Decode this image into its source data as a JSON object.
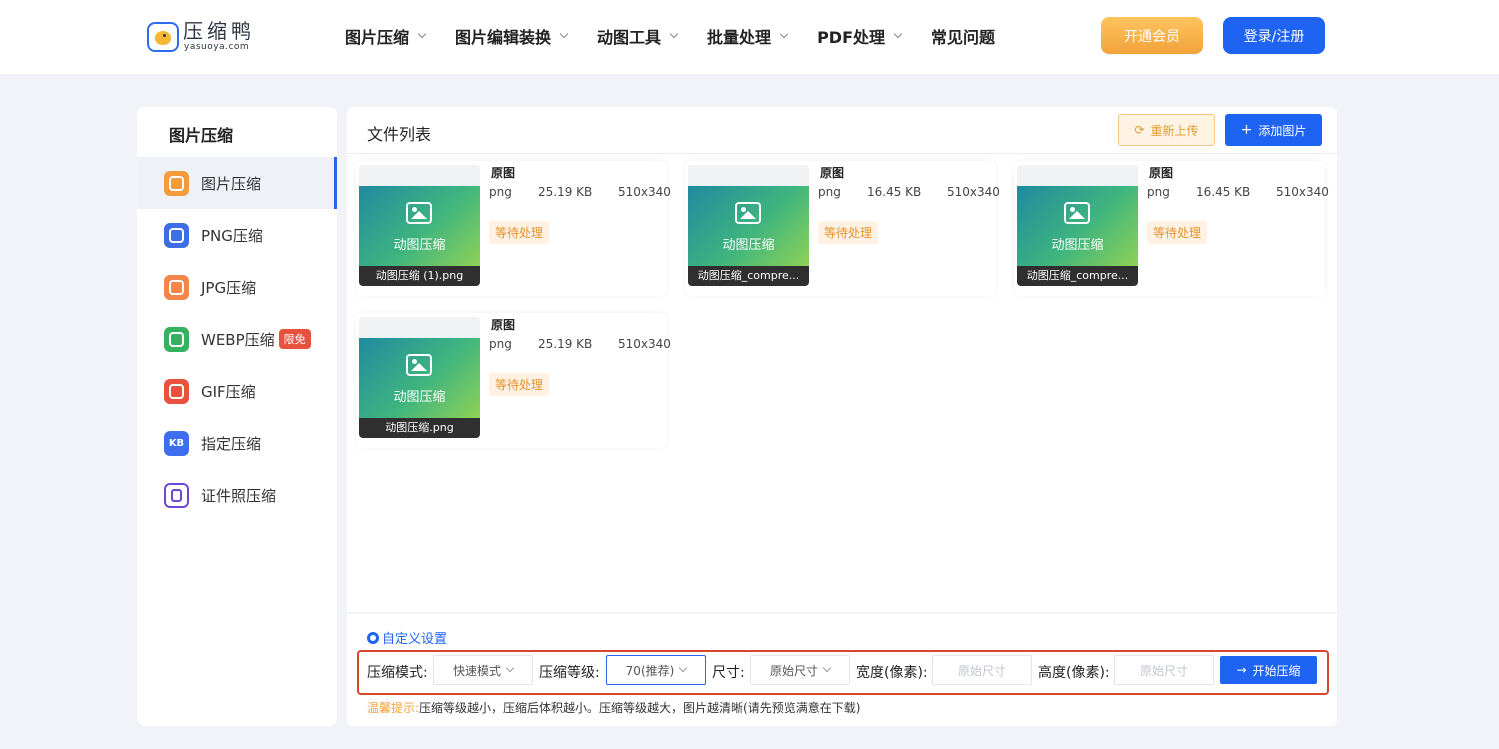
{
  "header": {
    "logo_title": "压缩鸭",
    "logo_sub": "yasuoya.com",
    "nav": [
      {
        "label": "图片压缩",
        "has_dropdown": true
      },
      {
        "label": "图片编辑装换",
        "has_dropdown": true
      },
      {
        "label": "动图工具",
        "has_dropdown": true
      },
      {
        "label": "批量处理",
        "has_dropdown": true
      },
      {
        "label": "PDF处理",
        "has_dropdown": true
      },
      {
        "label": "常见问题",
        "has_dropdown": false
      }
    ],
    "vip_button": "开通会员",
    "login_button": "登录/注册"
  },
  "sidebar": {
    "title": "图片压缩",
    "items": [
      {
        "label": "图片压缩",
        "active": true,
        "icon": "image-compress-icon",
        "color": "#f39a3d"
      },
      {
        "label": "PNG压缩",
        "active": false,
        "icon": "png-icon",
        "color": "#3e6de8"
      },
      {
        "label": "JPG压缩",
        "active": false,
        "icon": "jpg-icon",
        "color": "#f3864a"
      },
      {
        "label": "WEBP压缩",
        "active": false,
        "icon": "webp-icon",
        "color": "#35b25f",
        "badge": "限免"
      },
      {
        "label": "GIF压缩",
        "active": false,
        "icon": "gif-icon",
        "color": "#e9513f"
      },
      {
        "label": "指定压缩",
        "active": false,
        "icon": "kb-icon",
        "color": "#3f6df0",
        "icon_text": "KB"
      },
      {
        "label": "证件照压缩",
        "active": false,
        "icon": "id-photo-icon",
        "color": "#7046d8"
      }
    ]
  },
  "main": {
    "title": "文件列表",
    "reupload_button": "重新上传",
    "add_button": "添加图片",
    "files": [
      {
        "thumb_caption": "动图压缩",
        "name": "动图压缩 (1).png",
        "label": "原图",
        "format": "png",
        "size": "25.19 KB",
        "dimensions": "510x340",
        "status": "等待处理"
      },
      {
        "thumb_caption": "动图压缩",
        "name": "动图压缩_compre...",
        "label": "原图",
        "format": "png",
        "size": "16.45 KB",
        "dimensions": "510x340",
        "status": "等待处理"
      },
      {
        "thumb_caption": "动图压缩",
        "name": "动图压缩_compre...",
        "label": "原图",
        "format": "png",
        "size": "16.45 KB",
        "dimensions": "510x340",
        "status": "等待处理"
      },
      {
        "thumb_caption": "动图压缩",
        "name": "动图压缩.png",
        "label": "原图",
        "format": "png",
        "size": "25.19 KB",
        "dimensions": "510x340",
        "status": "等待处理"
      }
    ]
  },
  "settings": {
    "title": "自定义设置",
    "mode_label": "压缩模式:",
    "mode_value": "快速模式",
    "level_label": "压缩等级:",
    "level_value": "70(推荐)",
    "size_label": "尺寸:",
    "size_value": "原始尺寸",
    "width_label": "宽度(像素):",
    "width_placeholder": "原始尺寸",
    "height_label": "高度(像素):",
    "height_placeholder": "原始尺寸",
    "start_button": "开始压缩",
    "tip_label": "温馨提示:",
    "tip_text": "压缩等级越小，压缩后体积越小。压缩等级越大，图片越清晰(请先预览满意在下载)"
  },
  "colors": {
    "accent": "#1f63f2",
    "vip": "#f2a23a",
    "highlight_border": "#d9462e"
  }
}
